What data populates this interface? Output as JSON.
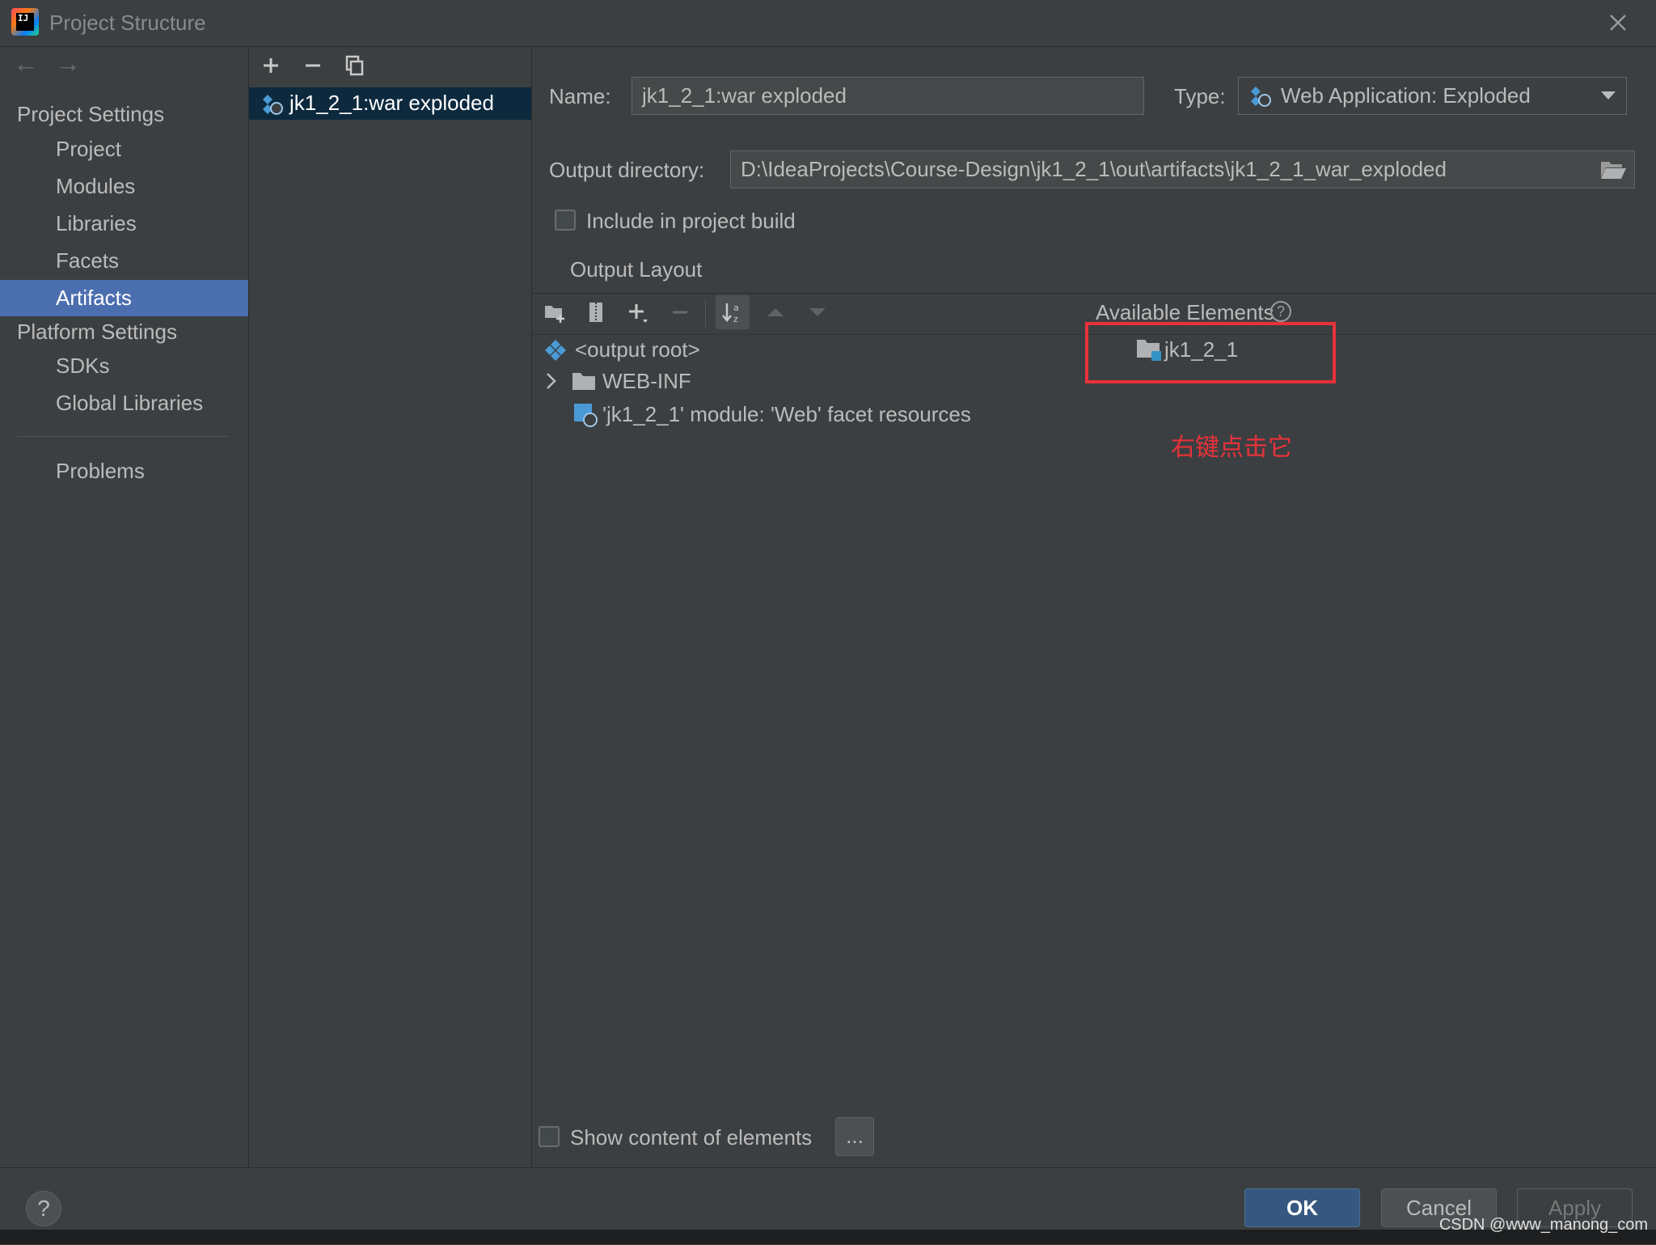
{
  "window": {
    "title": "Project Structure"
  },
  "sidebar": {
    "project_settings_header": "Project Settings",
    "items": [
      "Project",
      "Modules",
      "Libraries",
      "Facets",
      "Artifacts"
    ],
    "platform_settings_header": "Platform Settings",
    "platform_items": [
      "SDKs",
      "Global Libraries"
    ],
    "problems": "Problems",
    "selected": "Artifacts"
  },
  "artifacts": {
    "items": [
      "jk1_2_1:war exploded"
    ]
  },
  "details": {
    "name_label": "Name:",
    "name_value": "jk1_2_1:war exploded",
    "type_label": "Type:",
    "type_value": "Web Application: Exploded",
    "output_dir_label": "Output directory:",
    "output_dir_value": "D:\\IdeaProjects\\Course-Design\\jk1_2_1\\out\\artifacts\\jk1_2_1_war_exploded",
    "include_in_build": "Include in project build",
    "output_layout_tab": "Output Layout"
  },
  "layout_tree": {
    "root": "<output root>",
    "web_inf": "WEB-INF",
    "facet_resources": "'jk1_2_1' module: 'Web' facet resources"
  },
  "available": {
    "title": "Available Elements",
    "help": "?",
    "item": "jk1_2_1"
  },
  "annotation": "右键点击它",
  "footer": {
    "show_content": "Show content of elements",
    "ellipsis": "...",
    "ok": "OK",
    "cancel": "Cancel",
    "apply": "Apply",
    "help": "?"
  },
  "watermark": "CSDN @www_manong_com",
  "colors": {
    "background": "#3c3f41",
    "selection": "#4b6eaf",
    "list_selection": "#0d293e",
    "annotation_red": "#e8323a",
    "primary_button": "#365880"
  }
}
